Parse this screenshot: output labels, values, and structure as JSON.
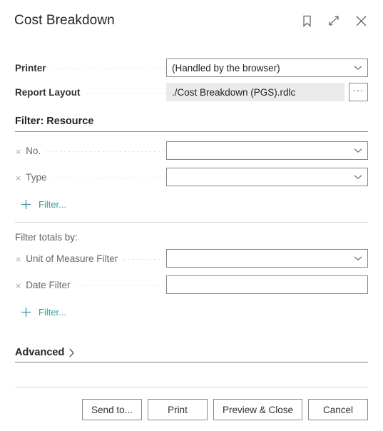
{
  "header": {
    "title": "Cost Breakdown",
    "actions": [
      {
        "name": "bookmark-icon",
        "label": "Bookmark"
      },
      {
        "name": "expand-icon",
        "label": "Expand"
      },
      {
        "name": "close-icon",
        "label": "Close"
      }
    ]
  },
  "general": {
    "printer": {
      "label": "Printer",
      "value": "(Handled by the browser)",
      "placeholder": ""
    },
    "report_layout": {
      "label": "Report Layout",
      "value": "./Cost Breakdown (PGS).rdlc",
      "ellipsis_label": "···"
    }
  },
  "filter_resource": {
    "section_title": "Filter: Resource",
    "clear_glyph": "×",
    "fields": [
      {
        "label": "No.",
        "value": "",
        "placeholder": "",
        "has_dropdown": true
      },
      {
        "label": "Type",
        "value": "",
        "placeholder": "",
        "has_dropdown": true
      }
    ],
    "add_filter_label": "Filter..."
  },
  "filter_totals": {
    "subhead": "Filter totals by:",
    "clear_glyph": "×",
    "fields": [
      {
        "label": "Unit of Measure Filter",
        "value": "",
        "placeholder": "",
        "has_dropdown": true
      },
      {
        "label": "Date Filter",
        "value": "",
        "placeholder": "",
        "has_dropdown": false
      }
    ],
    "add_filter_label": "Filter..."
  },
  "advanced": {
    "label": "Advanced",
    "chevron": "›"
  },
  "footer": {
    "buttons": [
      {
        "name": "send-to-button",
        "label": "Send to..."
      },
      {
        "name": "print-button",
        "label": "Print"
      },
      {
        "name": "preview-close-button",
        "label": "Preview & Close"
      },
      {
        "name": "cancel-button",
        "label": "Cancel"
      }
    ]
  },
  "colors": {
    "accent_link": "#3a9ba3",
    "text": "#323130",
    "muted_text": "#67696b",
    "border": "#8a8886",
    "readonly_bg": "#edebe9"
  }
}
